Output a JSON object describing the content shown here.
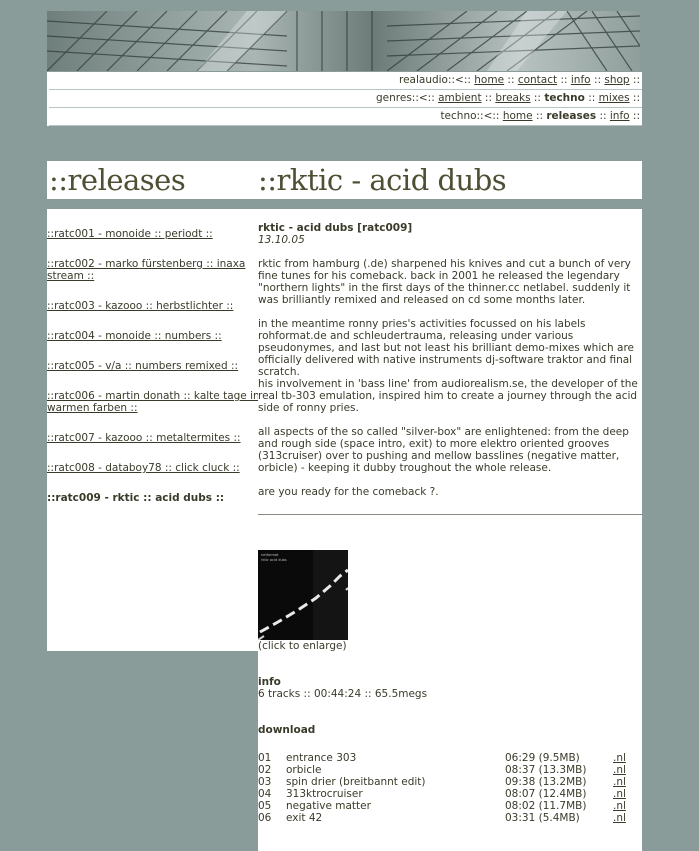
{
  "nav": {
    "rows": [
      {
        "prefix": "realaudio::<::",
        "items": [
          {
            "label": "home",
            "current": false
          },
          {
            "label": "contact",
            "current": false
          },
          {
            "label": "info",
            "current": false
          },
          {
            "label": "shop",
            "current": false
          }
        ],
        "suffix": "::"
      },
      {
        "prefix": "genres::<::",
        "items": [
          {
            "label": "ambient",
            "current": false
          },
          {
            "label": "breaks",
            "current": false
          },
          {
            "label": "techno",
            "current": true
          },
          {
            "label": "mixes",
            "current": false
          }
        ],
        "suffix": "::"
      },
      {
        "prefix": "techno::<::",
        "items": [
          {
            "label": "home",
            "current": false
          },
          {
            "label": "releases",
            "current": true
          },
          {
            "label": "info",
            "current": false
          }
        ],
        "suffix": "::"
      }
    ],
    "separator": "::"
  },
  "titles": {
    "left": "::releases",
    "right": "::rktic - acid dubs"
  },
  "releases": [
    {
      "text": "::ratc001 - monoide :: periodt ::",
      "current": false
    },
    {
      "text": "::ratc002 - marko fürstenberg :: inaxa stream ::",
      "current": false
    },
    {
      "text": "::ratc003 - kazooo :: herbstlichter ::",
      "current": false
    },
    {
      "text": "::ratc004 - monoide :: numbers ::",
      "current": false
    },
    {
      "text": "::ratc005 - v/a :: numbers remixed ::",
      "current": false
    },
    {
      "text": "::ratc006 - martin donath :: kalte tage in warmen farben ::",
      "current": false
    },
    {
      "text": "::ratc007 - kazooo :: metaltermites ::",
      "current": false
    },
    {
      "text": "::ratc008 - databoy78 :: click cluck ::",
      "current": false
    },
    {
      "text": "::ratc009 - rktic :: acid dubs ::",
      "current": true
    }
  ],
  "release": {
    "heading": "rktic - acid dubs [ratc009]",
    "date": "13.10.05",
    "paragraphs": [
      "rktic from hamburg (.de) sharpened his knives and cut a bunch of very fine tunes for his comeback. back in 2001 he released the legendary \"northern lights\" in the first days of the thinner.cc netlabel. suddenly it was brilliantly remixed and released on cd some months later.",
      "in the meantime ronny pries's activities focussed on his labels rohformat.de and schleudertrauma, releasing under various pseudonymes, and last but not least his brilliant demo-mixes which are officially delivered with native instruments dj-software traktor and final scratch.",
      "his involvement in 'bass line' from audiorealism.se, the developer of the real tb-303 emulation, inspired him to create a journey through the acid side of ronny pries.",
      "all aspects of the so called \"silver-box\" are enlightened: from the deep and rough side (space intro, exit) to more elektro oriented grooves (313cruiser) over to pushing and mellow basslines (negative matter, orbicle) - keeping it dubby troughout the whole release.",
      "are you ready for the comeback ?."
    ],
    "cover_caption": "(click to enlarge)",
    "cover_text": [
      "rohformat",
      "rktic acid dubs"
    ],
    "info_heading": "info",
    "info_text": "6 tracks :: 00:44:24 :: 65.5megs",
    "download_heading": "download",
    "tracks": [
      {
        "num": "01",
        "title": "entrance 303",
        "time": "06:29 (9.5MB)",
        "link": ".nl"
      },
      {
        "num": "02",
        "title": "orbicle",
        "time": "08:37 (13.3MB)",
        "link": ".nl"
      },
      {
        "num": "03",
        "title": "spin drier (breitbannt edit)",
        "time": "09:38 (13.2MB)",
        "link": ".nl"
      },
      {
        "num": "04",
        "title": "313ktrocruiser",
        "time": "08:07 (12.4MB)",
        "link": ".nl"
      },
      {
        "num": "05",
        "title": "negative matter",
        "time": "08:02 (11.7MB)",
        "link": ".nl"
      },
      {
        "num": "06",
        "title": "exit 42",
        "time": "03:31 (5.4MB)",
        "link": ".nl"
      }
    ]
  },
  "colors": {
    "page_background": "#8a9c9a",
    "text": "#3a3a2a",
    "title": "#4f4f34"
  }
}
